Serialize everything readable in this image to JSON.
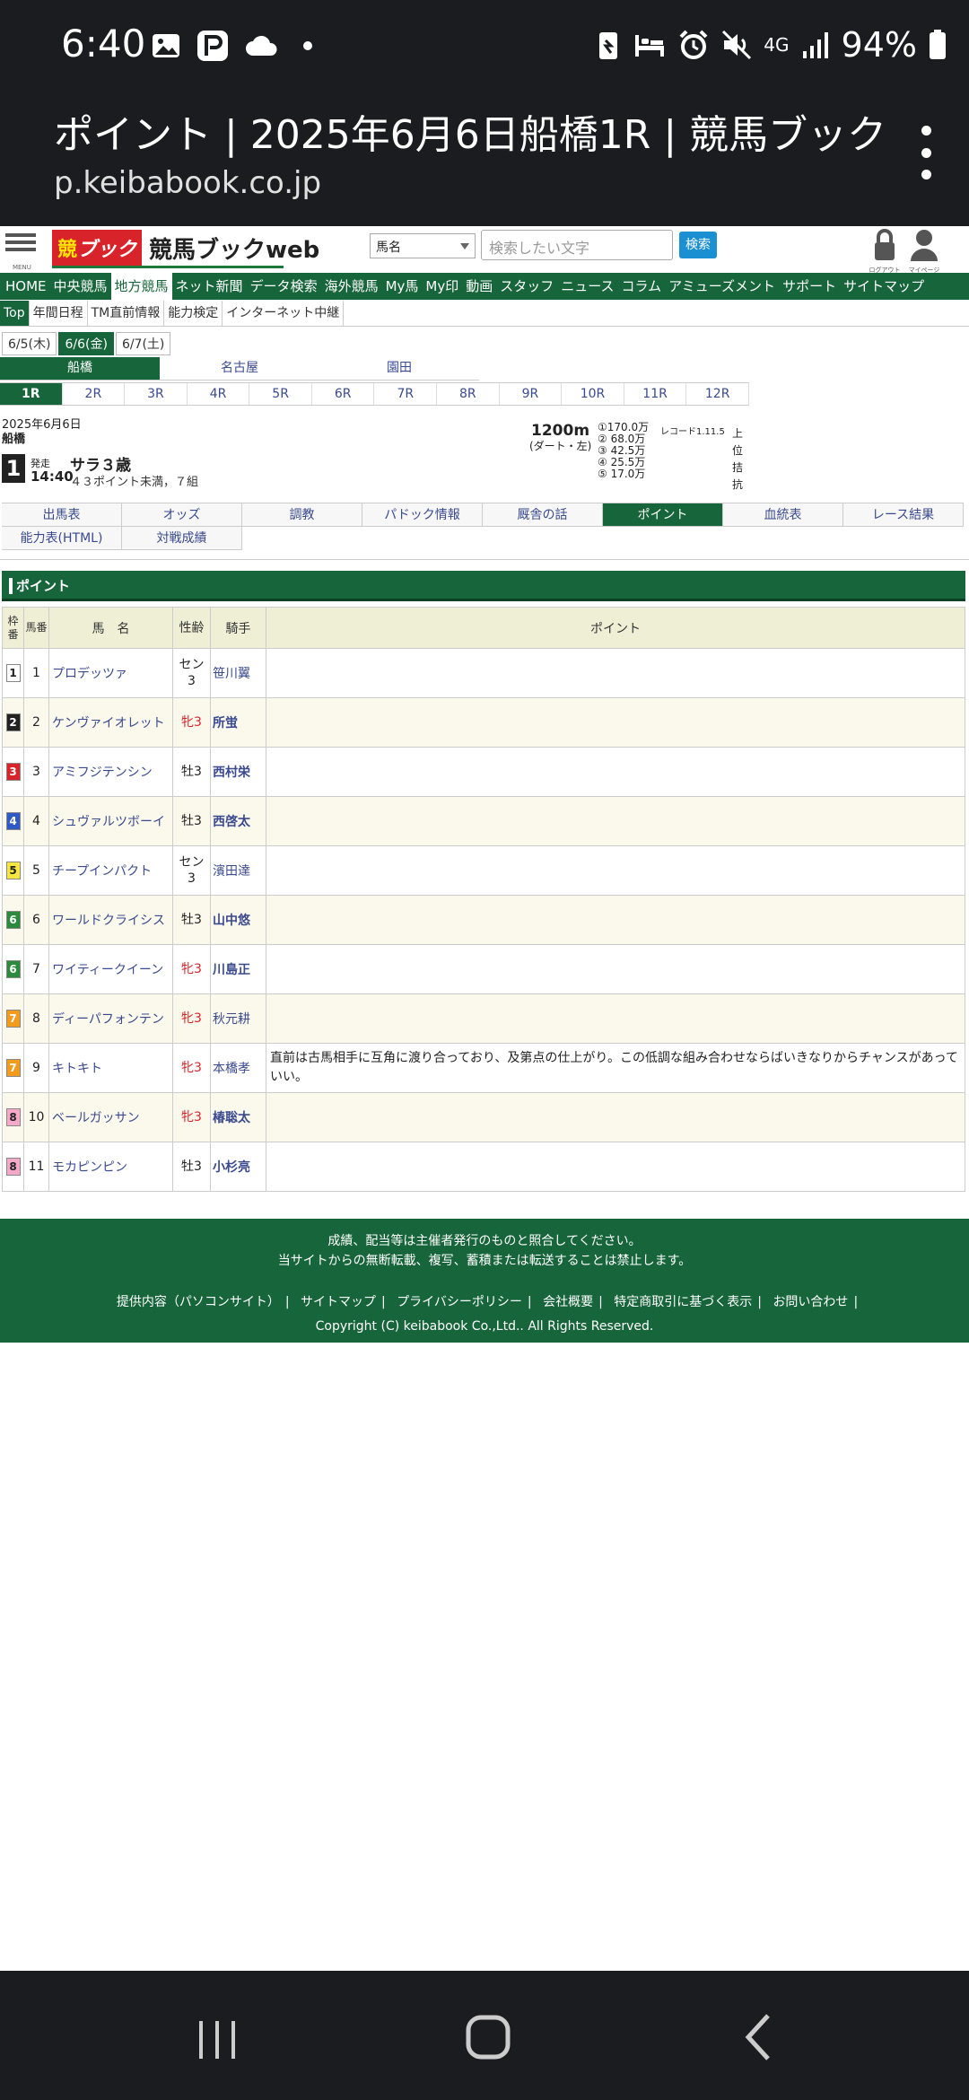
{
  "status": {
    "time": "6:40",
    "network": "4G",
    "battery": "94%"
  },
  "browser": {
    "title": "ポイント | 2025年6月6日船橋1R | 競馬ブック",
    "url": "p.keibabook.co.jp"
  },
  "header": {
    "menu_caption": "MENU",
    "logo_mark": "ブック",
    "logo_text": "競馬ブックweb",
    "search_select": "馬名",
    "search_placeholder": "検索したい文字",
    "search_button": "検索",
    "logout_caption": "ログアウト",
    "mypage_caption": "マイページ"
  },
  "global_nav": [
    "HOME",
    "中央競馬",
    "地方競馬",
    "ネット新聞",
    "データ検索",
    "海外競馬",
    "My馬",
    "My印",
    "動画",
    "スタッフ",
    "ニュース",
    "コラム",
    "アミューズメント",
    "サポート",
    "サイトマップ"
  ],
  "sub_nav": [
    "Top",
    "年間日程",
    "TM直前情報",
    "能力検定",
    "インターネット中継"
  ],
  "date_tabs": [
    "6/5(木)",
    "6/6(金)",
    "6/7(土)"
  ],
  "venues": [
    "船橋",
    "名古屋",
    "園田"
  ],
  "races": [
    "1R",
    "2R",
    "3R",
    "4R",
    "5R",
    "6R",
    "7R",
    "8R",
    "9R",
    "10R",
    "11R",
    "12R"
  ],
  "race": {
    "date": "2025年6月6日",
    "venue": "船橋",
    "number": "1",
    "start_label": "発走",
    "start_time": "14:40",
    "class": "サラ３歳",
    "conditions": "４３ポイント未満，７組",
    "distance": "1200m",
    "course": "(ダート・左)",
    "prizes": [
      "①170.0万",
      "② 68.0万",
      "③ 42.5万",
      "④ 25.5万",
      "⑤ 17.0万"
    ],
    "record": "レコード1.11.5",
    "side_label": "上位拮抗"
  },
  "menu_tabs": [
    "出馬表",
    "オッズ",
    "調教",
    "パドック情報",
    "厩舎の話",
    "ポイント",
    "血統表",
    "レース結果",
    "能力表(HTML)",
    "対戦成績"
  ],
  "section_title": "ポイント",
  "table": {
    "headers": {
      "waku": "枠番",
      "num": "馬番",
      "name": "馬　名",
      "sex_age": "性齢",
      "jockey": "騎手",
      "point": "ポイント"
    },
    "rows": [
      {
        "waku": "1",
        "num": "1",
        "name": "プロデッツァ",
        "sex_age": "セン3",
        "jockey": "笹川翼",
        "point": ""
      },
      {
        "waku": "2",
        "num": "2",
        "name": "ケンヴァイオレット",
        "sex_age": "牝3",
        "jockey": "所蛍",
        "point": ""
      },
      {
        "waku": "3",
        "num": "3",
        "name": "アミフジテンシン",
        "sex_age": "牡3",
        "jockey": "西村栄",
        "point": ""
      },
      {
        "waku": "4",
        "num": "4",
        "name": "シュヴァルツボーイ",
        "sex_age": "牡3",
        "jockey": "西啓太",
        "point": ""
      },
      {
        "waku": "5",
        "num": "5",
        "name": "チープインパクト",
        "sex_age": "セン3",
        "jockey": "濱田達",
        "point": ""
      },
      {
        "waku": "6",
        "num": "6",
        "name": "ワールドクライシス",
        "sex_age": "牡3",
        "jockey": "山中悠",
        "point": ""
      },
      {
        "waku": "6",
        "num": "7",
        "name": "ワイティークイーン",
        "sex_age": "牝3",
        "jockey": "川島正",
        "point": ""
      },
      {
        "waku": "7",
        "num": "8",
        "name": "ディーパフォンテン",
        "sex_age": "牝3",
        "jockey": "秋元耕",
        "point": ""
      },
      {
        "waku": "7",
        "num": "9",
        "name": "キトキト",
        "sex_age": "牝3",
        "jockey": "本橋孝",
        "point": "直前は古馬相手に互角に渡り合っており、及第点の仕上がり。この低調な組み合わせならばいきなりからチャンスがあっていい。"
      },
      {
        "waku": "8",
        "num": "10",
        "name": "ベールガッサン",
        "sex_age": "牝3",
        "jockey": "椿聡太",
        "point": ""
      },
      {
        "waku": "8",
        "num": "11",
        "name": "モカピンピン",
        "sex_age": "牡3",
        "jockey": "小杉亮",
        "point": ""
      }
    ]
  },
  "footer": {
    "line1": "成績、配当等は主催者発行のものと照合してください。",
    "line2": "当サイトからの無断転載、複写、蓄積または転送することは禁止します。",
    "links": [
      "提供内容（パソコンサイト）",
      "サイトマップ",
      "プライバシーポリシー",
      "会社概要",
      "特定商取引に基づく表示",
      "お問い合わせ"
    ],
    "copyright": "Copyright (C) keibabook Co.,Ltd.. All Rights Reserved."
  },
  "colors": {
    "brand_green": "#17653a",
    "logo_red": "#d8232a",
    "link_blue": "#3a4a8f",
    "header_beige": "#efefd6",
    "waku": {
      "1": "#ffffff",
      "2": "#222222",
      "3": "#d8232a",
      "4": "#2f59c4",
      "5": "#f5e642",
      "6": "#2c8a3f",
      "7": "#f29b1d",
      "8": "#f5a9c8"
    }
  }
}
